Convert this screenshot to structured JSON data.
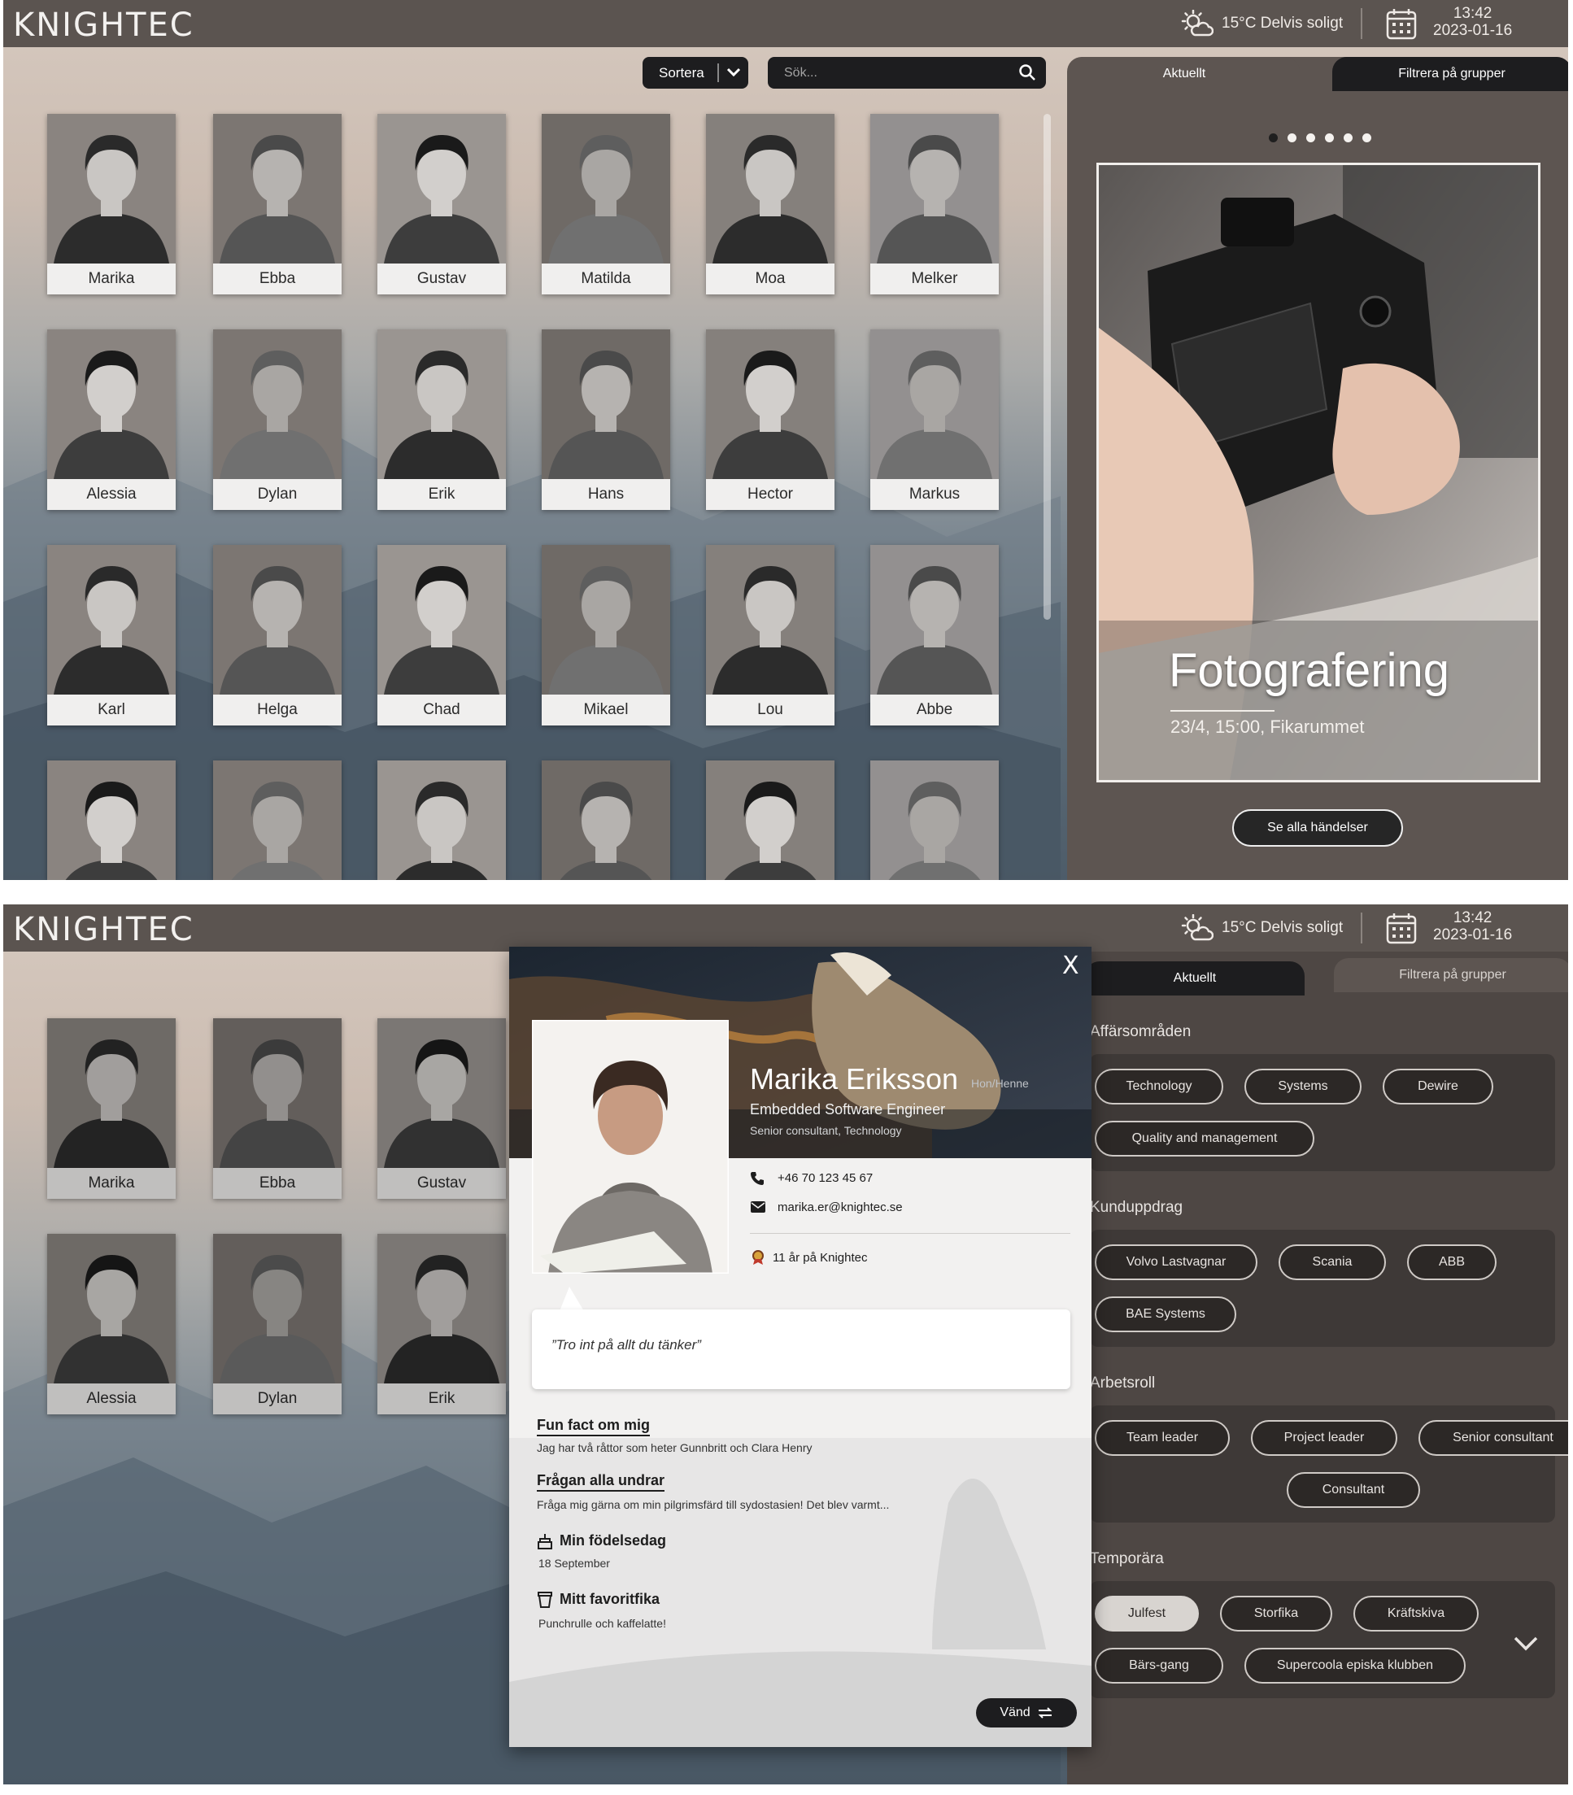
{
  "brand": "KNIGHTEC",
  "weather": {
    "text": "15°C Delvis soligt",
    "icon": "partly-sunny-icon"
  },
  "clock": {
    "time": "13:42",
    "date": "2023-01-16"
  },
  "sort_label": "Sortera",
  "search_placeholder": "Sök...",
  "tabs": {
    "current": "Aktuellt",
    "filter": "Filtrera på grupper"
  },
  "people": [
    {
      "name": "Marika"
    },
    {
      "name": "Ebba"
    },
    {
      "name": "Gustav"
    },
    {
      "name": "Matilda"
    },
    {
      "name": "Moa"
    },
    {
      "name": "Melker"
    },
    {
      "name": "Alessia"
    },
    {
      "name": "Dylan"
    },
    {
      "name": "Erik"
    },
    {
      "name": "Hans"
    },
    {
      "name": "Hector"
    },
    {
      "name": "Markus"
    },
    {
      "name": "Karl"
    },
    {
      "name": "Helga"
    },
    {
      "name": "Chad"
    },
    {
      "name": "Mikael"
    },
    {
      "name": "Lou"
    },
    {
      "name": "Abbe"
    },
    {
      "name": ""
    },
    {
      "name": ""
    },
    {
      "name": ""
    },
    {
      "name": ""
    },
    {
      "name": ""
    },
    {
      "name": ""
    }
  ],
  "carousel": {
    "count": 6,
    "active_index": 0
  },
  "event": {
    "title": "Fotografering",
    "details": "23/4, 15:00, Fikarummet"
  },
  "see_all_label": "Se alla händelser",
  "profile": {
    "name": "Marika Eriksson",
    "pronouns": "Hon/Henne",
    "title": "Embedded Software Engineer",
    "subtitle": "Senior consultant, Technology",
    "phone": "+46 70 123 45 67",
    "email": "marika.er@knightec.se",
    "tenure": "11 år på Knightec",
    "quote": "”Tro int på allt du tänker”",
    "fun_fact_heading": "Fun fact om mig",
    "fun_fact": "Jag har två råttor som heter Gunnbritt och Clara Henry",
    "question_heading": "Frågan alla undrar",
    "question": "Fråga mig gärna om min pilgrimsfärd till sydostasien! Det blev varmt...",
    "birthday_heading": "Min födelsedag",
    "birthday": "18 September",
    "fika_heading": "Mitt favoritfika",
    "fika": "Punchrulle och kaffelatte!",
    "flip_label": "Vänd",
    "close": "X"
  },
  "filters": {
    "business_areas": {
      "title": "Affärsområden",
      "chips": [
        "Technology",
        "Systems",
        "Dewire",
        "Quality and management"
      ]
    },
    "assignments": {
      "title": "Kunduppdrag",
      "chips": [
        "Volvo Lastvagnar",
        "Scania",
        "ABB",
        "BAE Systems"
      ]
    },
    "roles": {
      "title": "Arbetsroll",
      "chips": [
        "Team leader",
        "Project leader",
        "Senior consultant",
        "Consultant"
      ]
    },
    "temporary": {
      "title": "Temporära",
      "chips": [
        "Julfest",
        "Storfika",
        "Kräftskiva",
        "Bärs-gang",
        "Supercoola episka klubben"
      ],
      "selected": "Julfest"
    }
  },
  "colors": {
    "topbar": "#5b5450",
    "panel": "#5d5551",
    "chip_bg": "#2c2826",
    "accent_dark": "#1d1d1f"
  }
}
